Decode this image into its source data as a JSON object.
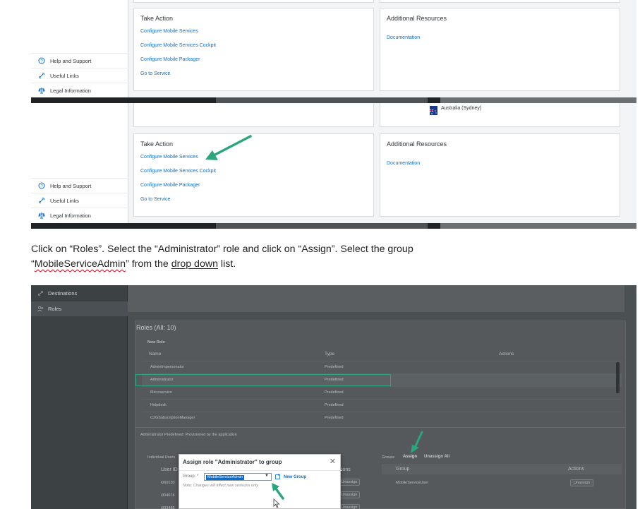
{
  "screenshot1": {
    "sidebar": {
      "items": [
        {
          "label": "Help and Support",
          "icon": "help-icon"
        },
        {
          "label": "Useful Links",
          "icon": "link-icon"
        },
        {
          "label": "Legal Information",
          "icon": "legal-icon"
        }
      ]
    },
    "take_action": {
      "title": "Take Action",
      "links": [
        "Configure Mobile Services",
        "Configure Mobile Services Cockpit",
        "Configure Mobile Packager",
        "Go to Service"
      ]
    },
    "additional_resources": {
      "title": "Additional Resources",
      "links": [
        "Documentation"
      ]
    }
  },
  "screenshot2": {
    "region_label": "Australia (Sydney)",
    "sidebar": {
      "items": [
        {
          "label": "Help and Support",
          "icon": "help-icon"
        },
        {
          "label": "Useful Links",
          "icon": "link-icon"
        },
        {
          "label": "Legal Information",
          "icon": "legal-icon"
        }
      ]
    },
    "take_action": {
      "title": "Take Action",
      "links": [
        "Configure Mobile Services",
        "Configure Mobile Services Cockpit",
        "Configure Mobile Packager",
        "Go to Service"
      ]
    },
    "additional_resources": {
      "title": "Additional Resources",
      "links": [
        "Documentation"
      ]
    },
    "arrow_color": "#2aa57c"
  },
  "instruction": {
    "part1": "Click on “Roles”. Select the “Administrator” role and click on “Assign”. Select the group",
    "quote_open": "“",
    "group_name": "MobileServiceAdmin",
    "part2": "” from the ",
    "link_text": "drop down",
    "part3": " list."
  },
  "screenshot3": {
    "sidebar": {
      "items": [
        {
          "label": "Destinations",
          "icon": "destinations-icon"
        },
        {
          "label": "Roles",
          "icon": "roles-icon"
        }
      ]
    },
    "roles_title": "Roles (All: 10)",
    "new_role": "New Role",
    "columns": [
      "Name",
      "Type",
      "Actions"
    ],
    "rows": [
      {
        "name": "AdminImpersonator",
        "type": "Predefined"
      },
      {
        "name": "Administrator",
        "type": "Predefined"
      },
      {
        "name": "Microservice",
        "type": "Predefined"
      },
      {
        "name": "Helpdesk",
        "type": "Predefined"
      },
      {
        "name": "C2GSubscriptionManager",
        "type": "Predefined"
      }
    ],
    "detail_line": "Administrator   Predefined: Provisioned by the application",
    "individual_users": "Individual Users",
    "user_id_col": "User ID",
    "users": [
      "i060130",
      "i304674",
      "i333485"
    ],
    "groups_label": "Groups",
    "assign": "Assign",
    "unassign_all": "Unassign All",
    "group_col": "Group",
    "group_actions_col": "Actions",
    "group_row": "MobileServiceUser",
    "unassign": "Unassign",
    "highlight_color": "#2aa57c"
  },
  "dialog": {
    "title": "Assign role \"Administrator\" to group",
    "close": "✕",
    "group_label": "Group: *",
    "selected": "MobileServiceAdmin",
    "new_group": "New Group",
    "note": "Note: Changes will affect new sessions only",
    "behind_actions": "tions",
    "behind_unassign": "Unassign"
  }
}
